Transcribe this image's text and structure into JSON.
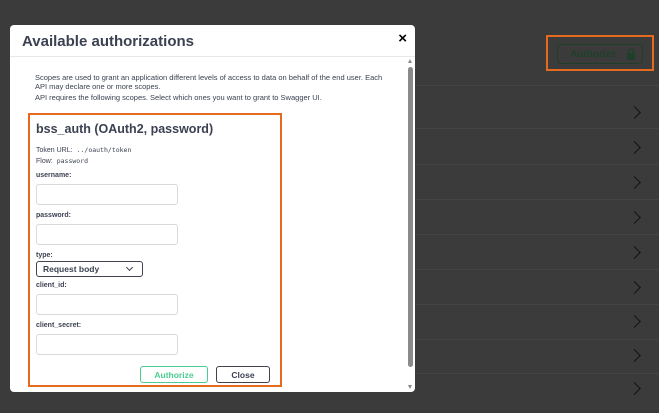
{
  "background": {
    "authorize_label": "Authorize",
    "lock_icon": "lock-icon",
    "accent": "#e56a1d"
  },
  "modal": {
    "title": "Available authorizations",
    "close_glyph": "×",
    "description_1": "Scopes are used to grant an application different levels of access to data on behalf of the end user. Each API may declare one or more scopes.",
    "description_2": "API requires the following scopes. Select which ones you want to grant to Swagger UI."
  },
  "auth": {
    "title": "bss_auth (OAuth2, password)",
    "token_url_label": "Token URL:",
    "token_url_value": "../oauth/token",
    "flow_label": "Flow:",
    "flow_value": "password",
    "username_label": "username:",
    "username_value": "",
    "password_label": "password:",
    "password_value": "",
    "type_label": "type:",
    "type_selected": "Request body",
    "client_id_label": "client_id:",
    "client_id_value": "",
    "client_secret_label": "client_secret:",
    "client_secret_value": "",
    "authorize_button": "Authorize",
    "close_button": "Close",
    "authorize_color": "#49cc90"
  }
}
